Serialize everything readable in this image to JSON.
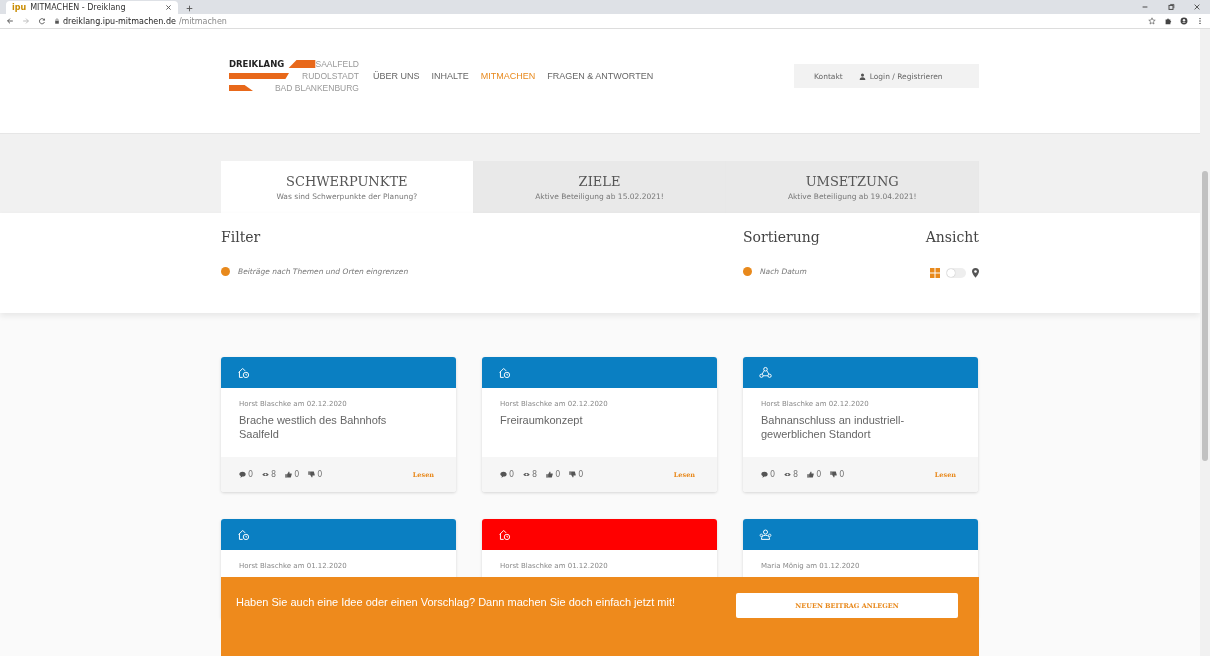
{
  "browser": {
    "tab_title": "MITMACHEN - Dreiklang",
    "tab_favicon": "ipu",
    "url_domain": "dreiklang.ipu-mitmachen.de",
    "url_path": "/mitmachen"
  },
  "logo": {
    "brand": "DREIKLANG",
    "towns": [
      "SAALFELD",
      "RUDOLSTADT",
      "BAD BLANKENBURG"
    ]
  },
  "nav": [
    {
      "label": "ÜBER UNS",
      "selected": false
    },
    {
      "label": "INHALTE",
      "selected": false
    },
    {
      "label": "MITMACHEN",
      "selected": true
    },
    {
      "label": "FRAGEN & ANTWORTEN",
      "selected": false
    }
  ],
  "account": {
    "contact": "Kontakt",
    "login": "Login / Registrieren"
  },
  "tabs": [
    {
      "title": "SCHWERPUNKTE",
      "subtitle": "Was sind Schwerpunkte der Planung?",
      "selected": true
    },
    {
      "title": "ZIELE",
      "subtitle": "Aktive Beteiligung ab 15.02.2021!",
      "selected": false
    },
    {
      "title": "UMSETZUNG",
      "subtitle": "Aktive Beteiligung ab 19.04.2021!",
      "selected": false
    }
  ],
  "filter": {
    "heading": "Filter",
    "option": "Beiträge nach Themen und Orten eingrenzen"
  },
  "sort": {
    "heading": "Sortierung",
    "option": "Nach Datum"
  },
  "view": {
    "heading": "Ansicht",
    "map_view": false
  },
  "cards": [
    {
      "kind": "building",
      "color": "#0a7fc2",
      "meta": "Horst Blaschke am 02.12.2020",
      "title": "Brache westlich des Bahnhofs Saalfeld",
      "stats": [
        "0",
        "8",
        "0",
        "0"
      ],
      "link": "Lesen"
    },
    {
      "kind": "building",
      "color": "#0a7fc2",
      "meta": "Horst Blaschke am 02.12.2020",
      "title": "Freiraumkonzept",
      "stats": [
        "0",
        "8",
        "0",
        "0"
      ],
      "link": "Lesen"
    },
    {
      "kind": "network",
      "color": "#0a7fc2",
      "meta": "Horst Blaschke am 02.12.2020",
      "title": "Bahnanschluss an industriell-gewerblichen Standort",
      "stats": [
        "0",
        "8",
        "0",
        "0"
      ],
      "link": "Lesen"
    },
    {
      "kind": "building",
      "color": "#0a7fc2",
      "meta": "Horst Blaschke am 01.12.2020"
    },
    {
      "kind": "building",
      "color": "#ff0000",
      "meta": "Horst Blaschke am 01.12.2020"
    },
    {
      "kind": "people",
      "color": "#0a7fc2",
      "meta": "Maria Mönig am 01.12.2020"
    }
  ],
  "banner": {
    "text": "Haben Sie auch eine Idee oder einen Vorschlag? Dann machen Sie doch einfach jetzt mit!",
    "button": "NEUEN BEITRAG ANLEGEN"
  }
}
